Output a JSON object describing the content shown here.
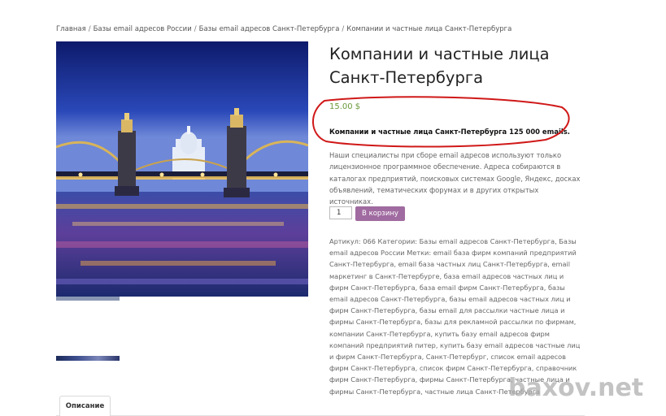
{
  "breadcrumb": {
    "items": [
      "Главная",
      "Базы email адресов России",
      "Базы email адресов Санкт-Петербурга",
      "Компании и частные лица Санкт-Петербурга"
    ],
    "separator": "/"
  },
  "product": {
    "title": "Компании и частные лица Санкт-Петербурга",
    "price": "15.00 $",
    "short_description": "Компании и частные лица Санкт-Петербурга 125 000 emails.",
    "intro": "Наши специалисты при сборе email адресов используют только лицензионное программное обеспечение. Адреса собираются в каталогах предприятий, поисковых системах Google, Яндекс, досках объявлений, тематических форумах и в других открытых источниках.",
    "quantity": "1",
    "add_to_cart_label": "В корзину",
    "meta": "Артикул: 066 Категории: Базы email адресов Санкт-Петербурга, Базы email адресов России Метки: email база фирм компаний предприятий Санкт-Петербурга, email база частных лиц Санкт-Петербурга, email маркетинг в Санкт-Петербурге, база email адресов частных лиц и фирм Санкт-Петербурга, база email фирм Санкт-Петербурга, базы email адресов Санкт-Петербурга, базы email адресов частных лиц и фирм Санкт-Петербурга, базы email для рассылки частные лица и фирмы Санкт-Петербурга, базы для рекламной рассылки по фирмам, компании Санкт-Петербурга, купить базу email адресов фирм компаний предприятий питер, купить базу email адресов частные лиц и фирм Санкт-Петербурга, Санкт-Петербург, список email адресов фирм Санкт-Петербурга, список фирм Санкт-Петербурга, справочник фирм Санкт-Петербурга, фирмы Санкт-Петербурга, частные лица и фирмы Санкт-Петербурга, частные лица Санкт-Петербурга"
  },
  "tabs": {
    "description_label": "Описание"
  },
  "watermark": "baxov.net",
  "colors": {
    "price": "#6a9a3b",
    "button": "#a06ba0",
    "annotation_oval": "#d01818"
  }
}
